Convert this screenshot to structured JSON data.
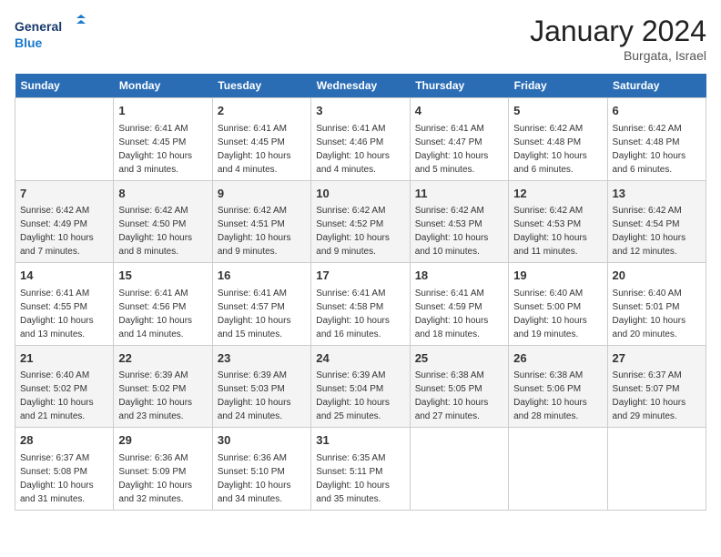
{
  "header": {
    "logo_general": "General",
    "logo_blue": "Blue",
    "month_title": "January 2024",
    "location": "Burgata, Israel"
  },
  "columns": [
    "Sunday",
    "Monday",
    "Tuesday",
    "Wednesday",
    "Thursday",
    "Friday",
    "Saturday"
  ],
  "weeks": [
    [
      {
        "day": "",
        "empty": true
      },
      {
        "day": "1",
        "sunrise": "6:41 AM",
        "sunset": "4:45 PM",
        "daylight": "10 hours and 3 minutes."
      },
      {
        "day": "2",
        "sunrise": "6:41 AM",
        "sunset": "4:45 PM",
        "daylight": "10 hours and 4 minutes."
      },
      {
        "day": "3",
        "sunrise": "6:41 AM",
        "sunset": "4:46 PM",
        "daylight": "10 hours and 4 minutes."
      },
      {
        "day": "4",
        "sunrise": "6:41 AM",
        "sunset": "4:47 PM",
        "daylight": "10 hours and 5 minutes."
      },
      {
        "day": "5",
        "sunrise": "6:42 AM",
        "sunset": "4:48 PM",
        "daylight": "10 hours and 6 minutes."
      },
      {
        "day": "6",
        "sunrise": "6:42 AM",
        "sunset": "4:48 PM",
        "daylight": "10 hours and 6 minutes."
      }
    ],
    [
      {
        "day": "7",
        "sunrise": "6:42 AM",
        "sunset": "4:49 PM",
        "daylight": "10 hours and 7 minutes."
      },
      {
        "day": "8",
        "sunrise": "6:42 AM",
        "sunset": "4:50 PM",
        "daylight": "10 hours and 8 minutes."
      },
      {
        "day": "9",
        "sunrise": "6:42 AM",
        "sunset": "4:51 PM",
        "daylight": "10 hours and 9 minutes."
      },
      {
        "day": "10",
        "sunrise": "6:42 AM",
        "sunset": "4:52 PM",
        "daylight": "10 hours and 9 minutes."
      },
      {
        "day": "11",
        "sunrise": "6:42 AM",
        "sunset": "4:53 PM",
        "daylight": "10 hours and 10 minutes."
      },
      {
        "day": "12",
        "sunrise": "6:42 AM",
        "sunset": "4:53 PM",
        "daylight": "10 hours and 11 minutes."
      },
      {
        "day": "13",
        "sunrise": "6:42 AM",
        "sunset": "4:54 PM",
        "daylight": "10 hours and 12 minutes."
      }
    ],
    [
      {
        "day": "14",
        "sunrise": "6:41 AM",
        "sunset": "4:55 PM",
        "daylight": "10 hours and 13 minutes."
      },
      {
        "day": "15",
        "sunrise": "6:41 AM",
        "sunset": "4:56 PM",
        "daylight": "10 hours and 14 minutes."
      },
      {
        "day": "16",
        "sunrise": "6:41 AM",
        "sunset": "4:57 PM",
        "daylight": "10 hours and 15 minutes."
      },
      {
        "day": "17",
        "sunrise": "6:41 AM",
        "sunset": "4:58 PM",
        "daylight": "10 hours and 16 minutes."
      },
      {
        "day": "18",
        "sunrise": "6:41 AM",
        "sunset": "4:59 PM",
        "daylight": "10 hours and 18 minutes."
      },
      {
        "day": "19",
        "sunrise": "6:40 AM",
        "sunset": "5:00 PM",
        "daylight": "10 hours and 19 minutes."
      },
      {
        "day": "20",
        "sunrise": "6:40 AM",
        "sunset": "5:01 PM",
        "daylight": "10 hours and 20 minutes."
      }
    ],
    [
      {
        "day": "21",
        "sunrise": "6:40 AM",
        "sunset": "5:02 PM",
        "daylight": "10 hours and 21 minutes."
      },
      {
        "day": "22",
        "sunrise": "6:39 AM",
        "sunset": "5:02 PM",
        "daylight": "10 hours and 23 minutes."
      },
      {
        "day": "23",
        "sunrise": "6:39 AM",
        "sunset": "5:03 PM",
        "daylight": "10 hours and 24 minutes."
      },
      {
        "day": "24",
        "sunrise": "6:39 AM",
        "sunset": "5:04 PM",
        "daylight": "10 hours and 25 minutes."
      },
      {
        "day": "25",
        "sunrise": "6:38 AM",
        "sunset": "5:05 PM",
        "daylight": "10 hours and 27 minutes."
      },
      {
        "day": "26",
        "sunrise": "6:38 AM",
        "sunset": "5:06 PM",
        "daylight": "10 hours and 28 minutes."
      },
      {
        "day": "27",
        "sunrise": "6:37 AM",
        "sunset": "5:07 PM",
        "daylight": "10 hours and 29 minutes."
      }
    ],
    [
      {
        "day": "28",
        "sunrise": "6:37 AM",
        "sunset": "5:08 PM",
        "daylight": "10 hours and 31 minutes."
      },
      {
        "day": "29",
        "sunrise": "6:36 AM",
        "sunset": "5:09 PM",
        "daylight": "10 hours and 32 minutes."
      },
      {
        "day": "30",
        "sunrise": "6:36 AM",
        "sunset": "5:10 PM",
        "daylight": "10 hours and 34 minutes."
      },
      {
        "day": "31",
        "sunrise": "6:35 AM",
        "sunset": "5:11 PM",
        "daylight": "10 hours and 35 minutes."
      },
      {
        "day": "",
        "empty": true
      },
      {
        "day": "",
        "empty": true
      },
      {
        "day": "",
        "empty": true
      }
    ]
  ]
}
